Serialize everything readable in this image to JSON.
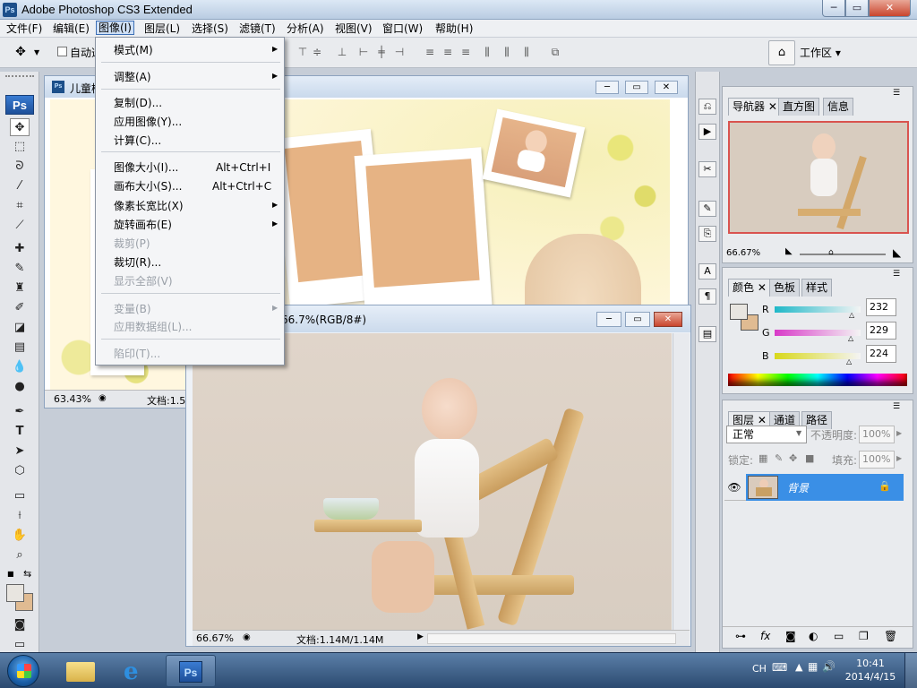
{
  "window": {
    "title": "Adobe Photoshop CS3 Extended",
    "min": "─",
    "max": "▭",
    "close": "✕"
  },
  "menubar": [
    "文件(F)",
    "编辑(E)",
    "图像(I)",
    "图层(L)",
    "选择(S)",
    "滤镜(T)",
    "分析(A)",
    "视图(V)",
    "窗口(W)",
    "帮助(H)"
  ],
  "optionsbar": {
    "auto_select": "自动选择",
    "workspace": "工作区 ▾"
  },
  "doc1": {
    "title": "儿童模板",
    "zoom": "63.43%",
    "doc_info": "文档:1.5"
  },
  "doc2": {
    "title": "66.7%(RGB/8#)",
    "zoom": "66.67%",
    "doc_info": "文档:1.14M/1.14M"
  },
  "image_menu": {
    "items": [
      {
        "label": "模式(M)",
        "submenu": true
      },
      {
        "label": "调整(A)",
        "submenu": true
      },
      {
        "label": "复制(D)..."
      },
      {
        "label": "应用图像(Y)..."
      },
      {
        "label": "计算(C)..."
      },
      {
        "label": "图像大小(I)...",
        "shortcut": "Alt+Ctrl+I"
      },
      {
        "label": "画布大小(S)...",
        "shortcut": "Alt+Ctrl+C"
      },
      {
        "label": "像素长宽比(X)",
        "submenu": true
      },
      {
        "label": "旋转画布(E)",
        "submenu": true
      },
      {
        "label": "裁剪(P)",
        "disabled": true
      },
      {
        "label": "裁切(R)..."
      },
      {
        "label": "显示全部(V)",
        "disabled": true
      },
      {
        "label": "变量(B)",
        "submenu": true,
        "disabled": true
      },
      {
        "label": "应用数据组(L)...",
        "disabled": true
      },
      {
        "label": "陷印(T)...",
        "disabled": true
      }
    ]
  },
  "navigator_panel": {
    "tabs": [
      "导航器",
      "直方图",
      "信息"
    ],
    "zoom": "66.67%"
  },
  "color_panel": {
    "tabs": [
      "颜色",
      "色板",
      "样式"
    ],
    "channels": [
      {
        "label": "R",
        "value": "232",
        "color": "#1fb8c8"
      },
      {
        "label": "G",
        "value": "229",
        "color": "#d83ac8"
      },
      {
        "label": "B",
        "value": "224",
        "color": "#d8d81a"
      }
    ],
    "fg_color": "#e8e5e0",
    "bg_color": "#e0bb92"
  },
  "layers_panel": {
    "tabs": [
      "图层",
      "通道",
      "路径"
    ],
    "blend_mode": "正常",
    "opacity_label": "不透明度:",
    "opacity": "100%",
    "lock_label": "锁定:",
    "fill_label": "填充:",
    "fill": "100%",
    "layers": [
      {
        "name": "背景",
        "selected": true
      }
    ]
  },
  "taskbar": {
    "ime": "CH",
    "time": "10:41",
    "date": "2014/4/15"
  }
}
